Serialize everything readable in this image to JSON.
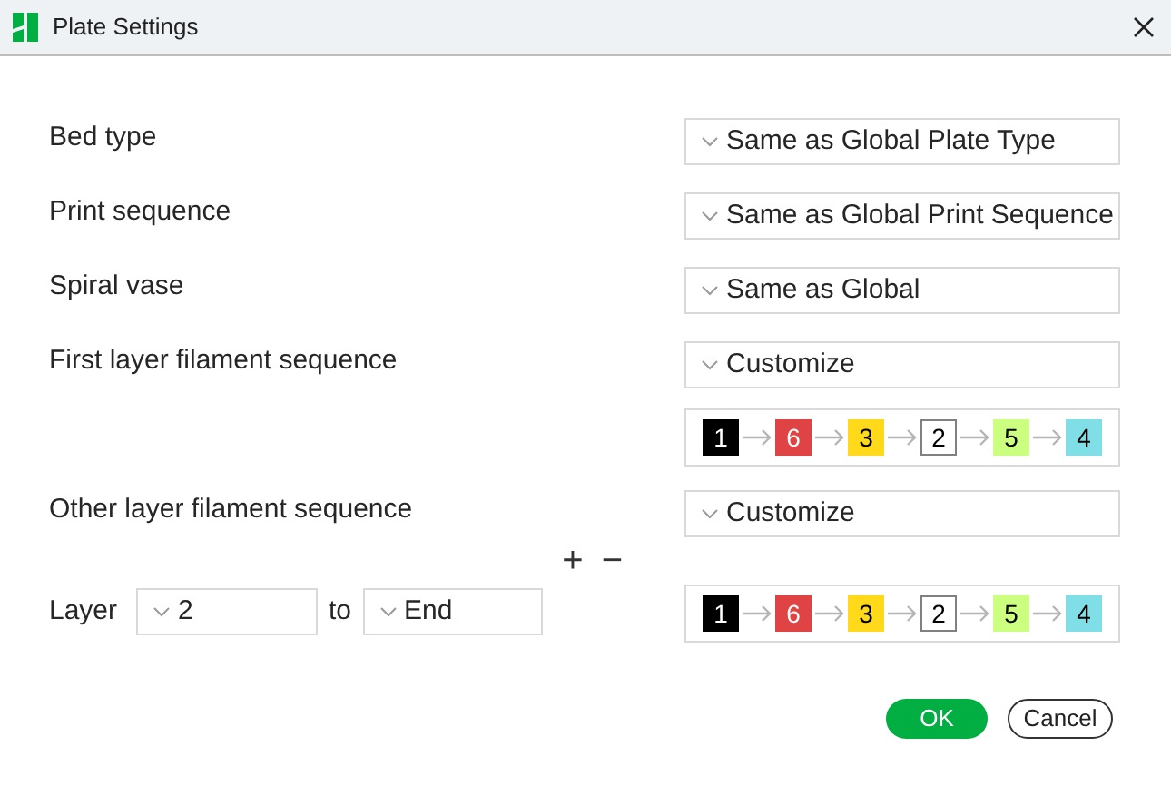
{
  "window": {
    "title": "Plate Settings"
  },
  "settings": [
    {
      "label": "Bed type",
      "value": "Same as Global Plate Type"
    },
    {
      "label": "Print sequence",
      "value": "Same as Global Print Sequence"
    },
    {
      "label": "Spiral vase",
      "value": "Same as Global"
    },
    {
      "label": "First layer filament sequence",
      "value": "Customize"
    }
  ],
  "first_layer_sequence": [
    {
      "text": "1",
      "color": "#000000"
    },
    {
      "text": "6",
      "color": "#e04343"
    },
    {
      "text": "3",
      "color": "#ffd91a"
    },
    {
      "text": "2",
      "color": "#ffffff"
    },
    {
      "text": "5",
      "color": "#ccff80"
    },
    {
      "text": "4",
      "color": "#80dfe6"
    }
  ],
  "other_layer": {
    "label": "Other layer filament sequence",
    "value": "Customize",
    "add": "+",
    "remove": "−",
    "layer_label": "Layer",
    "from": "2",
    "to_label": "to",
    "to": "End",
    "sequence": [
      {
        "text": "1",
        "color": "#000000"
      },
      {
        "text": "6",
        "color": "#e04343"
      },
      {
        "text": "3",
        "color": "#ffd91a"
      },
      {
        "text": "2",
        "color": "#ffffff"
      },
      {
        "text": "5",
        "color": "#ccff80"
      },
      {
        "text": "4",
        "color": "#80dfe6"
      }
    ]
  },
  "buttons": [
    {
      "label": "OK",
      "kind": "primary"
    },
    {
      "label": "Cancel",
      "kind": "secondary"
    }
  ]
}
